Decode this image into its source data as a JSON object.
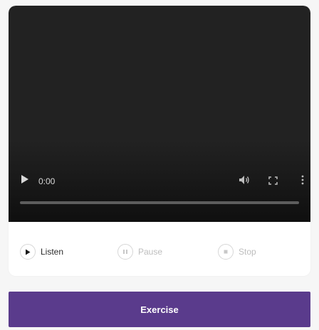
{
  "video": {
    "current_time": "0:00",
    "progress_fraction": 0,
    "icons": {
      "play": "play-icon",
      "volume": "volume-icon",
      "fullscreen": "fullscreen-icon",
      "more": "more-options-icon"
    }
  },
  "audio_controls": {
    "listen_label": "Listen",
    "pause_label": "Pause",
    "stop_label": "Stop",
    "icons": {
      "listen": "play-icon",
      "pause": "pause-icon",
      "stop": "stop-icon"
    }
  },
  "exercise": {
    "label": "Exercise"
  },
  "colors": {
    "accent": "#5a3b8c",
    "video_background": "#222222",
    "card_background": "#ffffff",
    "page_background": "#f6f6f6",
    "disabled_text": "#bdbdbd"
  }
}
